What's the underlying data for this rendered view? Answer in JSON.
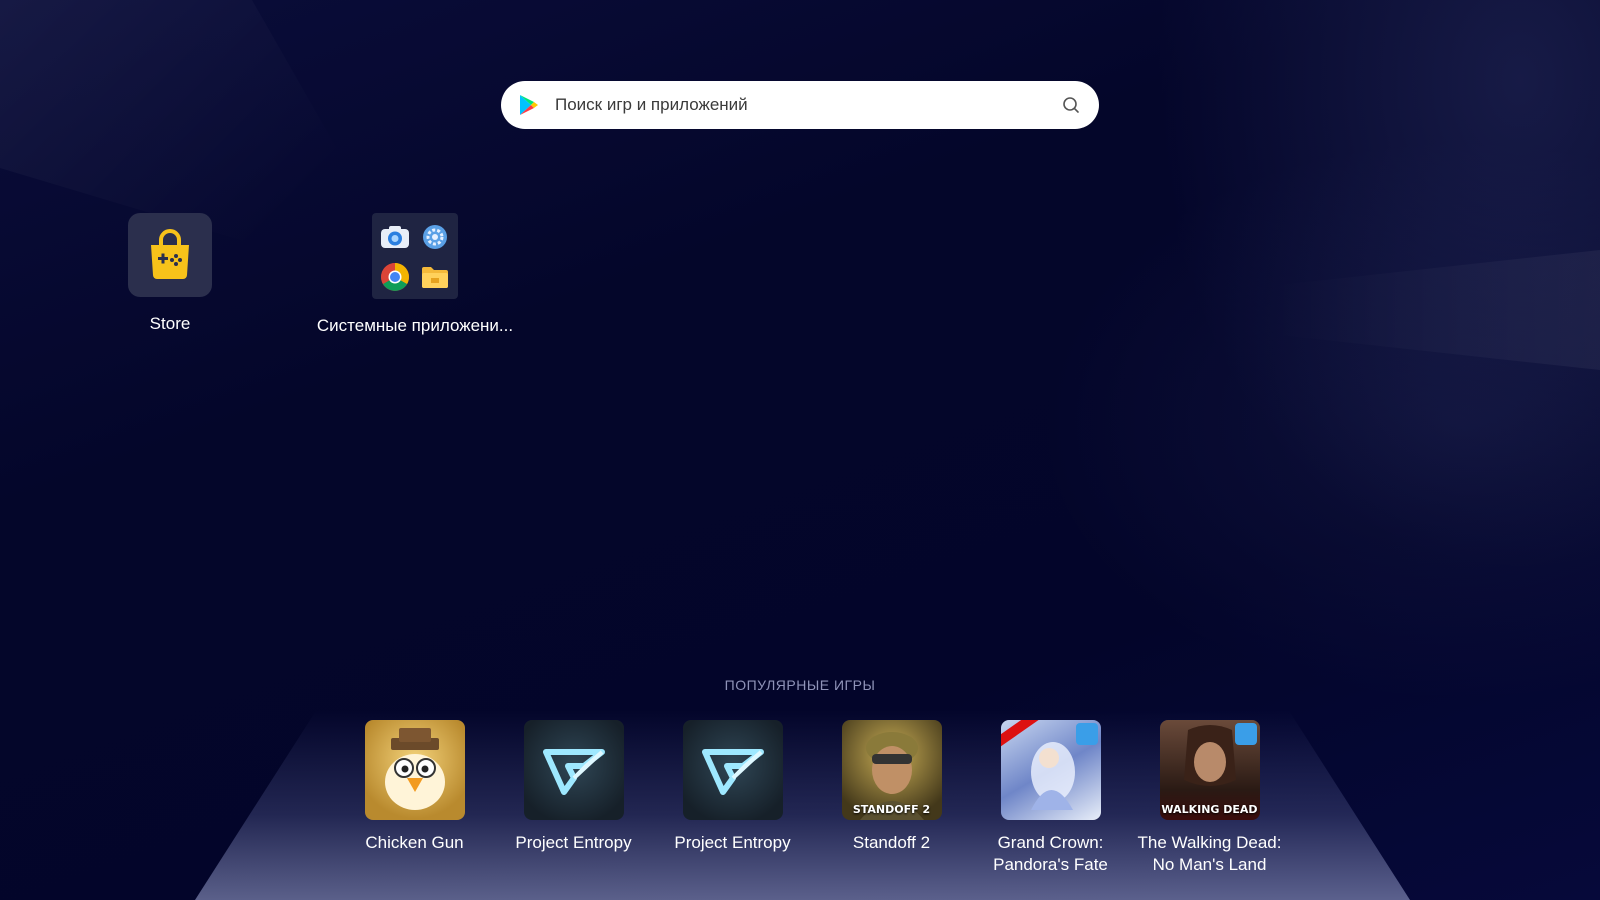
{
  "search": {
    "placeholder": "Поиск игр и приложений",
    "logo_icon": "play-store-icon",
    "action_icon": "search-icon"
  },
  "desktop": {
    "store": {
      "label": "Store",
      "icon": "store-bag-gamepad-icon",
      "accent": "#f7c21a"
    },
    "system_apps": {
      "label": "Системные приложени...",
      "icons": [
        "camera-icon",
        "settings-icon",
        "chrome-icon",
        "folder-icon"
      ]
    }
  },
  "popular": {
    "title": "ПОПУЛЯРНЫЕ ИГРЫ",
    "games": [
      {
        "name": "Chicken Gun",
        "icon": "chicken-gun-cover"
      },
      {
        "name": "Project Entropy",
        "icon": "project-entropy-cover"
      },
      {
        "name": "Project Entropy",
        "icon": "project-entropy-cover"
      },
      {
        "name": "Standoff 2",
        "icon": "standoff-2-cover",
        "cover_text": "STANDOFF 2"
      },
      {
        "name": "Grand Crown: Pandora's Fate",
        "icon": "grand-crown-cover"
      },
      {
        "name": "The Walking Dead: No Man's Land",
        "icon": "walking-dead-cover",
        "cover_text": "WALKING DEAD"
      }
    ]
  },
  "colors": {
    "background": "#04062a",
    "search_bg": "#ffffff",
    "section_title": "#8f93b8"
  }
}
